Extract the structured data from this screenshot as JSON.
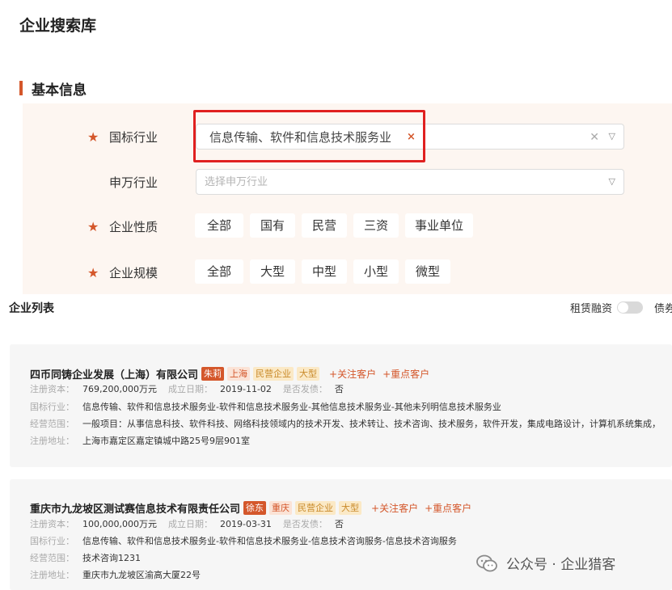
{
  "page": {
    "title": "企业搜索库"
  },
  "basic_info": {
    "title": "基本信息",
    "industry": {
      "label": "国标行业",
      "selected": "信息传输、软件和信息技术服务业"
    },
    "sw_industry": {
      "label": "申万行业",
      "placeholder": "选择申万行业"
    },
    "nature": {
      "label": "企业性质",
      "options": [
        "全部",
        "国有",
        "民营",
        "三资",
        "事业单位"
      ]
    },
    "scale": {
      "label": "企业规模",
      "options": [
        "全部",
        "大型",
        "中型",
        "小型",
        "微型"
      ]
    }
  },
  "list": {
    "title": "企业列表",
    "toggle_label": "租赁融资",
    "tool2_label": "债券"
  },
  "labels": {
    "capital": "注册资本：",
    "founded": "成立日期：",
    "bond": "是否发债：",
    "industry": "国标行业：",
    "scope": "经营范围：",
    "address": "注册地址："
  },
  "companies": [
    {
      "name": "四币同铸企业发展（上海）有限公司",
      "owner": "朱莉",
      "region": "上海",
      "type": "民营企业",
      "scale": "大型",
      "follow": "+关注客户",
      "key": "+重点客户",
      "capital": "769,200,000万元",
      "founded": "2019-11-02",
      "bond": "否",
      "industry": "信息传输、软件和信息技术服务业-软件和信息技术服务业-其他信息技术服务业-其他未列明信息技术服务业",
      "scope": "一般项目：从事信息科技、软件科技、网络科技领域内的技术开发、技术转让、技术咨询、技术服务，软件开发，集成电路设计，计算机系统集成，",
      "address": "上海市嘉定区嘉定镇城中路25号9层901室"
    },
    {
      "name": "重庆市九龙坡区测试赛信息技术有限责任公司",
      "owner": "徐东",
      "region": "重庆",
      "type": "民营企业",
      "scale": "大型",
      "follow": "+关注客户",
      "key": "+重点客户",
      "capital": "100,000,000万元",
      "founded": "2019-03-31",
      "bond": "否",
      "industry": "信息传输、软件和信息技术服务业-软件和信息技术服务业-信息技术咨询服务-信息技术咨询服务",
      "scope": "技术咨询1231",
      "address": "重庆市九龙坡区渝高大厦22号"
    }
  ],
  "watermark": {
    "text": "公众号 · 企业猎客"
  },
  "colors": {
    "accent": "#d4572b",
    "highlight": "#e02020",
    "panel": "#fdf6f1",
    "card": "#f6f6f6"
  }
}
